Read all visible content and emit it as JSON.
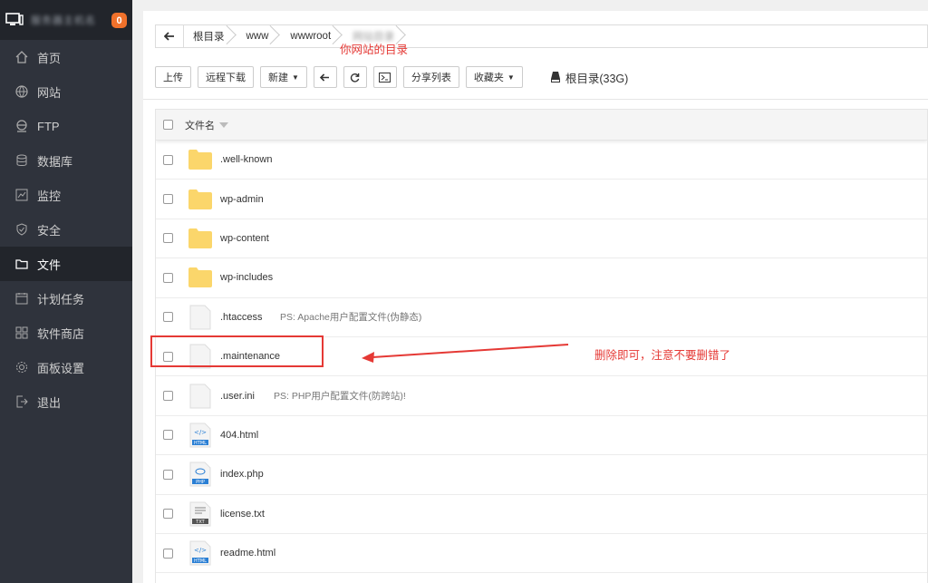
{
  "sidebar": {
    "host_label": "服务器主机名",
    "badge": "0",
    "items": [
      {
        "label": "首页",
        "icon": "home-icon"
      },
      {
        "label": "网站",
        "icon": "globe-icon"
      },
      {
        "label": "FTP",
        "icon": "ftp-icon"
      },
      {
        "label": "数据库",
        "icon": "database-icon"
      },
      {
        "label": "监控",
        "icon": "monitor-icon"
      },
      {
        "label": "安全",
        "icon": "shield-icon"
      },
      {
        "label": "文件",
        "icon": "folder-icon",
        "active": true
      },
      {
        "label": "计划任务",
        "icon": "calendar-icon"
      },
      {
        "label": "软件商店",
        "icon": "apps-icon"
      },
      {
        "label": "面板设置",
        "icon": "gear-icon"
      },
      {
        "label": "退出",
        "icon": "logout-icon"
      }
    ]
  },
  "breadcrumb": {
    "items": [
      "根目录",
      "www",
      "wwwroot",
      "网站目录"
    ],
    "annotation": "你网站的目录"
  },
  "toolbar": {
    "upload": "上传",
    "remote_download": "远程下载",
    "new": "新建",
    "share_list": "分享列表",
    "favorites": "收藏夹",
    "disk": "根目录(33G)"
  },
  "filelist": {
    "header": "文件名",
    "rows": [
      {
        "name": ".well-known",
        "type": "folder",
        "ps": ""
      },
      {
        "name": "wp-admin",
        "type": "folder",
        "ps": ""
      },
      {
        "name": "wp-content",
        "type": "folder",
        "ps": ""
      },
      {
        "name": "wp-includes",
        "type": "folder",
        "ps": ""
      },
      {
        "name": ".htaccess",
        "type": "file",
        "ps": "PS: Apache用户配置文件(伪静态)"
      },
      {
        "name": ".maintenance",
        "type": "file",
        "ps": ""
      },
      {
        "name": ".user.ini",
        "type": "file",
        "ps": "PS: PHP用户配置文件(防跨站)!"
      },
      {
        "name": "404.html",
        "type": "html",
        "ps": ""
      },
      {
        "name": "index.php",
        "type": "php",
        "ps": ""
      },
      {
        "name": "license.txt",
        "type": "txt",
        "ps": ""
      },
      {
        "name": "readme.html",
        "type": "html",
        "ps": ""
      }
    ]
  },
  "annotation_delete": "删除即可，注意不要删错了",
  "colors": {
    "sidebar_bg": "#2f333c",
    "sidebar_active": "#22252b",
    "annotation_red": "#e53935",
    "folder_yellow": "#fbd66b",
    "badge_orange": "#f0712b"
  }
}
